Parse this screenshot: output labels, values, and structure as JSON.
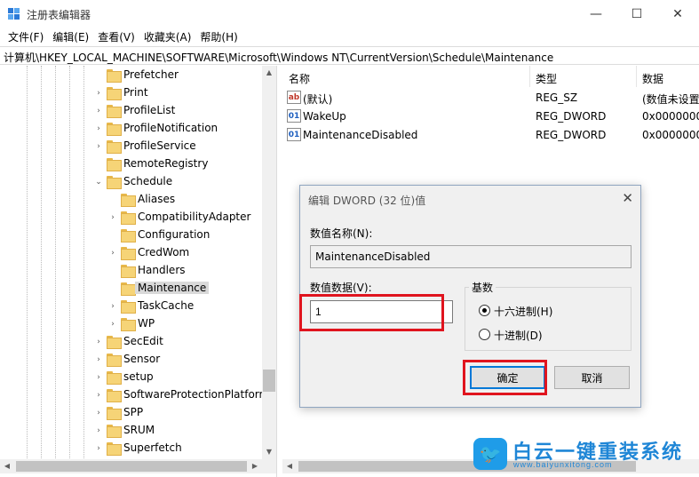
{
  "window": {
    "title": "注册表编辑器",
    "minimize": "—",
    "maximize": "☐",
    "close": "✕"
  },
  "menu": [
    "文件(F)",
    "编辑(E)",
    "查看(V)",
    "收藏夹(A)",
    "帮助(H)"
  ],
  "address": "计算机\\HKEY_LOCAL_MACHINE\\SOFTWARE\\Microsoft\\Windows NT\\CurrentVersion\\Schedule\\Maintenance",
  "tree": [
    {
      "label": "Prefetcher",
      "expander": ""
    },
    {
      "label": "Print",
      "expander": "›"
    },
    {
      "label": "ProfileList",
      "expander": "›"
    },
    {
      "label": "ProfileNotification",
      "expander": "›"
    },
    {
      "label": "ProfileService",
      "expander": "›"
    },
    {
      "label": "RemoteRegistry",
      "expander": ""
    },
    {
      "label": "Schedule",
      "expander": "⌄"
    },
    {
      "label": "Aliases",
      "expander": ""
    },
    {
      "label": "CompatibilityAdapter",
      "expander": "›"
    },
    {
      "label": "Configuration",
      "expander": ""
    },
    {
      "label": "CredWom",
      "expander": "›"
    },
    {
      "label": "Handlers",
      "expander": ""
    },
    {
      "label": "Maintenance",
      "expander": "",
      "selected": true
    },
    {
      "label": "TaskCache",
      "expander": "›"
    },
    {
      "label": "WP",
      "expander": "›"
    },
    {
      "label": "SecEdit",
      "expander": "›"
    },
    {
      "label": "Sensor",
      "expander": "›"
    },
    {
      "label": "setup",
      "expander": "›"
    },
    {
      "label": "SoftwareProtectionPlatform",
      "expander": "›"
    },
    {
      "label": "SPP",
      "expander": "›"
    },
    {
      "label": "SRUM",
      "expander": "›"
    },
    {
      "label": "Superfetch",
      "expander": "›"
    }
  ],
  "list": {
    "headers": {
      "name": "名称",
      "type": "类型",
      "data": "数据"
    },
    "rows": [
      {
        "icon": "ab",
        "name": "(默认)",
        "type": "REG_SZ",
        "data": "(数值未设置"
      },
      {
        "icon": "bin",
        "name": "WakeUp",
        "type": "REG_DWORD",
        "data": "0x0000000"
      },
      {
        "icon": "bin",
        "name": "MaintenanceDisabled",
        "type": "REG_DWORD",
        "data": "0x0000000"
      }
    ]
  },
  "dialog": {
    "title": "编辑 DWORD (32 位)值",
    "close": "✕",
    "name_label": "数值名称(N):",
    "name_value": "MaintenanceDisabled",
    "data_label": "数值数据(V):",
    "data_value": "1",
    "base_title": "基数",
    "radio_hex": "十六进制(H)",
    "radio_dec": "十进制(D)",
    "ok": "确定",
    "cancel": "取消"
  },
  "watermark": {
    "brand": "白云一键重装系统",
    "url": "www.baiyunxitong.com"
  },
  "colors": {
    "highlight": "#e0141e",
    "selection": "#d9d9d9",
    "folder": "#f6d477",
    "accent": "#0078d7"
  }
}
